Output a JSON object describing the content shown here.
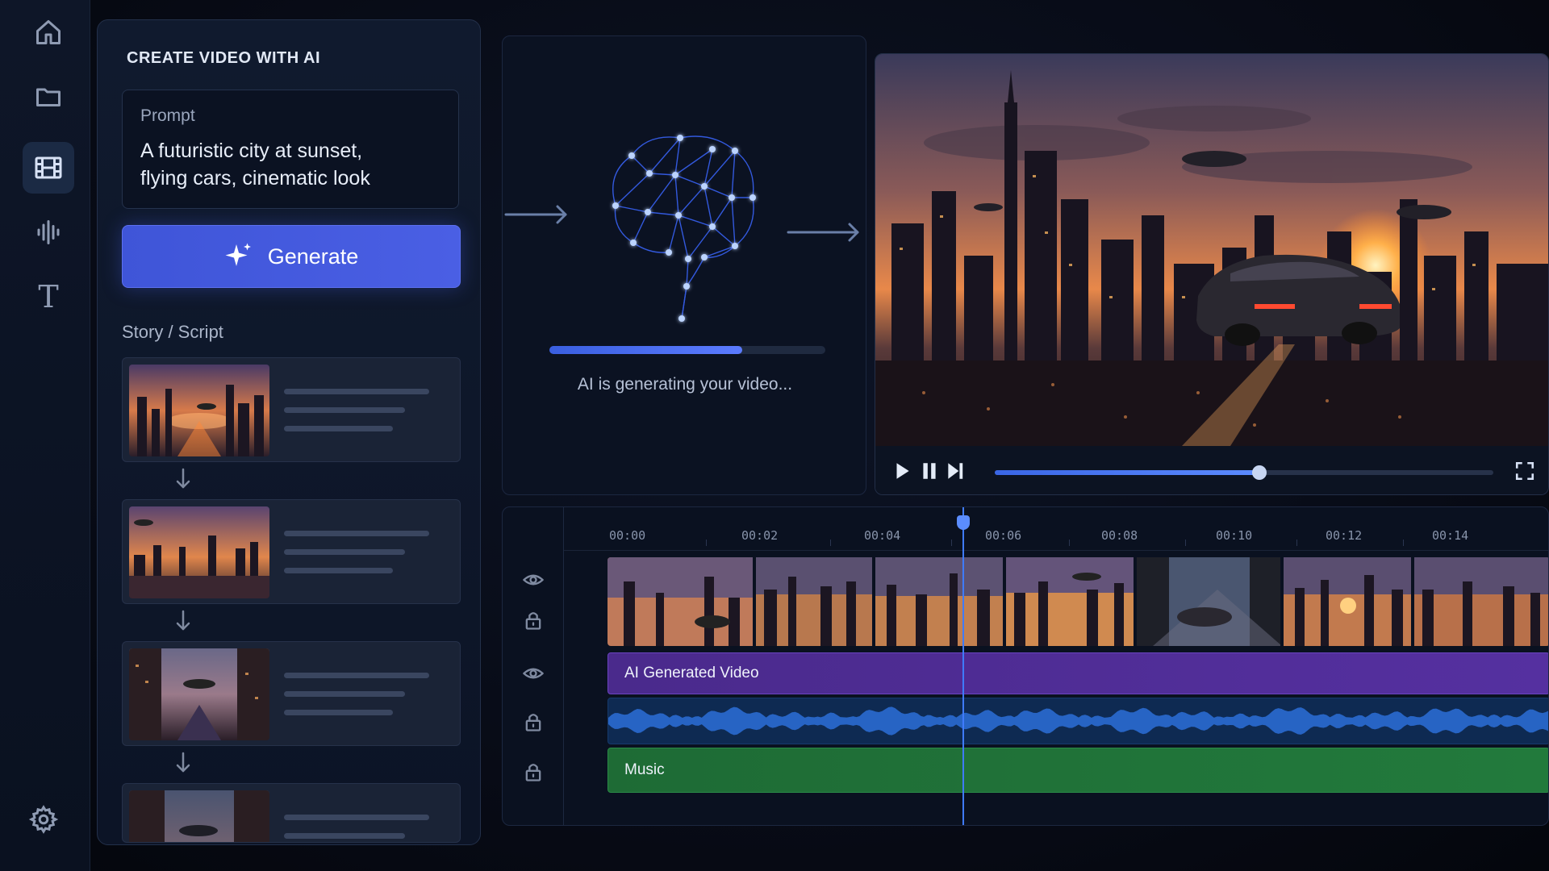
{
  "app": {
    "colors": {
      "accent": "#4a5fe4",
      "video_track": "#5530a0",
      "audio_track": "#0e2a52",
      "music_track": "#227a3c",
      "playhead": "#3f7bff"
    }
  },
  "sidebar": {
    "items": [
      {
        "icon": "home-icon"
      },
      {
        "icon": "folder-icon"
      },
      {
        "icon": "film-icon",
        "active": true
      },
      {
        "icon": "audio-waveform-icon"
      },
      {
        "icon": "text-icon",
        "glyph": "T"
      }
    ],
    "settings_icon": "gear-icon"
  },
  "create_panel": {
    "title": "CREATE VIDEO WITH AI",
    "prompt": {
      "label": "Prompt",
      "line1": "A futuristic city at sunset,",
      "line2": "flying cars, cinematic look"
    },
    "generate_button": {
      "label": "Generate",
      "icon": "sparkle-icon"
    },
    "story_label": "Story / Script",
    "story_cards": 4
  },
  "generation": {
    "status": "AI is generating your video...",
    "progress": 0.7,
    "icon": "neural-brain-icon"
  },
  "preview": {
    "playback_progress": 0.53,
    "controls": [
      "play-icon",
      "pause-icon",
      "skip-next-icon",
      "fullscreen-icon"
    ]
  },
  "timeline": {
    "ticks": [
      "00:00",
      "00:02",
      "00:04",
      "00:06",
      "00:08",
      "00:10",
      "00:12",
      "00:14"
    ],
    "tracks": {
      "video": "AI Generated Video",
      "music": "Music"
    }
  }
}
